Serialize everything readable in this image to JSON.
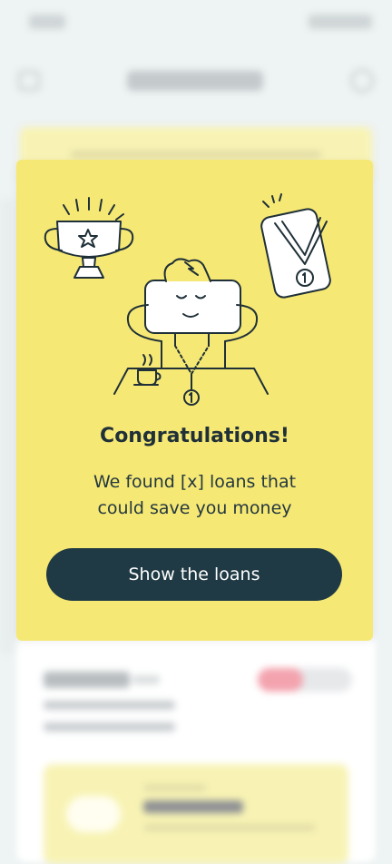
{
  "modal": {
    "title": "Congratulations!",
    "description": "We found [x] loans that\ncould save you money",
    "button_label": "Show the loans"
  },
  "illustration": {
    "trophy_icon": "trophy-icon",
    "medal_icon": "medal-icon",
    "medal_number": "1",
    "person": "relaxed-person-with-medal",
    "cup": "coffee-cup-icon"
  },
  "colors": {
    "modal_background": "#f6e874",
    "button_background": "#1f3a44",
    "text_dark": "#1f3038",
    "backdrop": "#eef3f3"
  }
}
